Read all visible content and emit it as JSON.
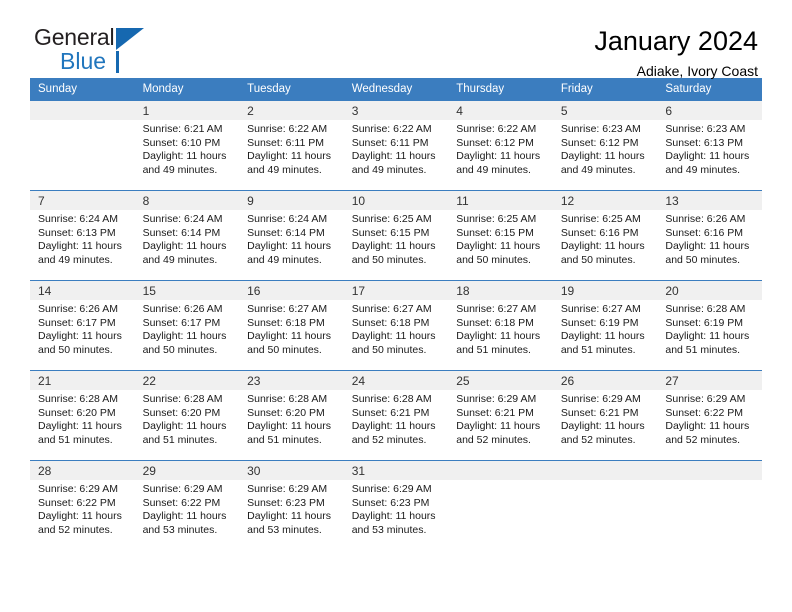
{
  "brand": {
    "name_top": "General",
    "name_bottom": "Blue",
    "accent_color": "#1668b0"
  },
  "header": {
    "title": "January 2024",
    "subtitle": "Adiake, Ivory Coast"
  },
  "calendar": {
    "header_bg": "#3b7dbf",
    "daynum_bg": "#f0f0f0",
    "weekday_headers": [
      "Sunday",
      "Monday",
      "Tuesday",
      "Wednesday",
      "Thursday",
      "Friday",
      "Saturday"
    ],
    "labels": {
      "sunrise": "Sunrise:",
      "sunset": "Sunset:",
      "daylight": "Daylight:"
    },
    "weeks": [
      [
        {
          "day": "",
          "empty": true
        },
        {
          "day": "1",
          "sunrise": "Sunrise: 6:21 AM",
          "sunset": "Sunset: 6:10 PM",
          "daylight_line1": "Daylight: 11 hours",
          "daylight_line2": "and 49 minutes."
        },
        {
          "day": "2",
          "sunrise": "Sunrise: 6:22 AM",
          "sunset": "Sunset: 6:11 PM",
          "daylight_line1": "Daylight: 11 hours",
          "daylight_line2": "and 49 minutes."
        },
        {
          "day": "3",
          "sunrise": "Sunrise: 6:22 AM",
          "sunset": "Sunset: 6:11 PM",
          "daylight_line1": "Daylight: 11 hours",
          "daylight_line2": "and 49 minutes."
        },
        {
          "day": "4",
          "sunrise": "Sunrise: 6:22 AM",
          "sunset": "Sunset: 6:12 PM",
          "daylight_line1": "Daylight: 11 hours",
          "daylight_line2": "and 49 minutes."
        },
        {
          "day": "5",
          "sunrise": "Sunrise: 6:23 AM",
          "sunset": "Sunset: 6:12 PM",
          "daylight_line1": "Daylight: 11 hours",
          "daylight_line2": "and 49 minutes."
        },
        {
          "day": "6",
          "sunrise": "Sunrise: 6:23 AM",
          "sunset": "Sunset: 6:13 PM",
          "daylight_line1": "Daylight: 11 hours",
          "daylight_line2": "and 49 minutes."
        }
      ],
      [
        {
          "day": "7",
          "sunrise": "Sunrise: 6:24 AM",
          "sunset": "Sunset: 6:13 PM",
          "daylight_line1": "Daylight: 11 hours",
          "daylight_line2": "and 49 minutes."
        },
        {
          "day": "8",
          "sunrise": "Sunrise: 6:24 AM",
          "sunset": "Sunset: 6:14 PM",
          "daylight_line1": "Daylight: 11 hours",
          "daylight_line2": "and 49 minutes."
        },
        {
          "day": "9",
          "sunrise": "Sunrise: 6:24 AM",
          "sunset": "Sunset: 6:14 PM",
          "daylight_line1": "Daylight: 11 hours",
          "daylight_line2": "and 49 minutes."
        },
        {
          "day": "10",
          "sunrise": "Sunrise: 6:25 AM",
          "sunset": "Sunset: 6:15 PM",
          "daylight_line1": "Daylight: 11 hours",
          "daylight_line2": "and 50 minutes."
        },
        {
          "day": "11",
          "sunrise": "Sunrise: 6:25 AM",
          "sunset": "Sunset: 6:15 PM",
          "daylight_line1": "Daylight: 11 hours",
          "daylight_line2": "and 50 minutes."
        },
        {
          "day": "12",
          "sunrise": "Sunrise: 6:25 AM",
          "sunset": "Sunset: 6:16 PM",
          "daylight_line1": "Daylight: 11 hours",
          "daylight_line2": "and 50 minutes."
        },
        {
          "day": "13",
          "sunrise": "Sunrise: 6:26 AM",
          "sunset": "Sunset: 6:16 PM",
          "daylight_line1": "Daylight: 11 hours",
          "daylight_line2": "and 50 minutes."
        }
      ],
      [
        {
          "day": "14",
          "sunrise": "Sunrise: 6:26 AM",
          "sunset": "Sunset: 6:17 PM",
          "daylight_line1": "Daylight: 11 hours",
          "daylight_line2": "and 50 minutes."
        },
        {
          "day": "15",
          "sunrise": "Sunrise: 6:26 AM",
          "sunset": "Sunset: 6:17 PM",
          "daylight_line1": "Daylight: 11 hours",
          "daylight_line2": "and 50 minutes."
        },
        {
          "day": "16",
          "sunrise": "Sunrise: 6:27 AM",
          "sunset": "Sunset: 6:18 PM",
          "daylight_line1": "Daylight: 11 hours",
          "daylight_line2": "and 50 minutes."
        },
        {
          "day": "17",
          "sunrise": "Sunrise: 6:27 AM",
          "sunset": "Sunset: 6:18 PM",
          "daylight_line1": "Daylight: 11 hours",
          "daylight_line2": "and 50 minutes."
        },
        {
          "day": "18",
          "sunrise": "Sunrise: 6:27 AM",
          "sunset": "Sunset: 6:18 PM",
          "daylight_line1": "Daylight: 11 hours",
          "daylight_line2": "and 51 minutes."
        },
        {
          "day": "19",
          "sunrise": "Sunrise: 6:27 AM",
          "sunset": "Sunset: 6:19 PM",
          "daylight_line1": "Daylight: 11 hours",
          "daylight_line2": "and 51 minutes."
        },
        {
          "day": "20",
          "sunrise": "Sunrise: 6:28 AM",
          "sunset": "Sunset: 6:19 PM",
          "daylight_line1": "Daylight: 11 hours",
          "daylight_line2": "and 51 minutes."
        }
      ],
      [
        {
          "day": "21",
          "sunrise": "Sunrise: 6:28 AM",
          "sunset": "Sunset: 6:20 PM",
          "daylight_line1": "Daylight: 11 hours",
          "daylight_line2": "and 51 minutes."
        },
        {
          "day": "22",
          "sunrise": "Sunrise: 6:28 AM",
          "sunset": "Sunset: 6:20 PM",
          "daylight_line1": "Daylight: 11 hours",
          "daylight_line2": "and 51 minutes."
        },
        {
          "day": "23",
          "sunrise": "Sunrise: 6:28 AM",
          "sunset": "Sunset: 6:20 PM",
          "daylight_line1": "Daylight: 11 hours",
          "daylight_line2": "and 51 minutes."
        },
        {
          "day": "24",
          "sunrise": "Sunrise: 6:28 AM",
          "sunset": "Sunset: 6:21 PM",
          "daylight_line1": "Daylight: 11 hours",
          "daylight_line2": "and 52 minutes."
        },
        {
          "day": "25",
          "sunrise": "Sunrise: 6:29 AM",
          "sunset": "Sunset: 6:21 PM",
          "daylight_line1": "Daylight: 11 hours",
          "daylight_line2": "and 52 minutes."
        },
        {
          "day": "26",
          "sunrise": "Sunrise: 6:29 AM",
          "sunset": "Sunset: 6:21 PM",
          "daylight_line1": "Daylight: 11 hours",
          "daylight_line2": "and 52 minutes."
        },
        {
          "day": "27",
          "sunrise": "Sunrise: 6:29 AM",
          "sunset": "Sunset: 6:22 PM",
          "daylight_line1": "Daylight: 11 hours",
          "daylight_line2": "and 52 minutes."
        }
      ],
      [
        {
          "day": "28",
          "sunrise": "Sunrise: 6:29 AM",
          "sunset": "Sunset: 6:22 PM",
          "daylight_line1": "Daylight: 11 hours",
          "daylight_line2": "and 52 minutes."
        },
        {
          "day": "29",
          "sunrise": "Sunrise: 6:29 AM",
          "sunset": "Sunset: 6:22 PM",
          "daylight_line1": "Daylight: 11 hours",
          "daylight_line2": "and 53 minutes."
        },
        {
          "day": "30",
          "sunrise": "Sunrise: 6:29 AM",
          "sunset": "Sunset: 6:23 PM",
          "daylight_line1": "Daylight: 11 hours",
          "daylight_line2": "and 53 minutes."
        },
        {
          "day": "31",
          "sunrise": "Sunrise: 6:29 AM",
          "sunset": "Sunset: 6:23 PM",
          "daylight_line1": "Daylight: 11 hours",
          "daylight_line2": "and 53 minutes."
        },
        {
          "day": "",
          "empty": true
        },
        {
          "day": "",
          "empty": true
        },
        {
          "day": "",
          "empty": true
        }
      ]
    ]
  }
}
